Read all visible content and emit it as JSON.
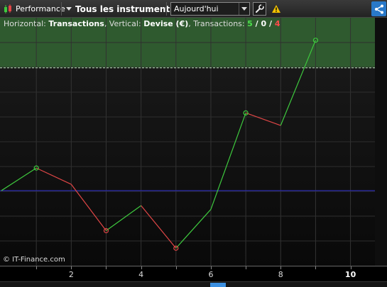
{
  "toolbar": {
    "performance_label": "Performance",
    "instruments_label": "Tous les instruments",
    "period_value": "Aujourd'hui",
    "icons": [
      "candlestick-icon",
      "chevron-down-icon",
      "wrench-icon",
      "warning-icon",
      "share-icon"
    ]
  },
  "chart": {
    "horizontal_prefix": "Horizontal: ",
    "horizontal_value": "Transactions",
    "vertical_prefix": ", Vertical: ",
    "vertical_value": "Devise (€)",
    "transactions_prefix": ", Transactions: ",
    "wins": "5",
    "sep1": " / ",
    "neutral": "0",
    "sep2": " / ",
    "losses": "4",
    "copyright": "© IT-Finance.com"
  },
  "colors": {
    "gain": "#3ec93e",
    "loss": "#e04646",
    "baseline": "#2a2acc",
    "target_zone": "#2f5a2f",
    "share": "#2979c9"
  },
  "chart_data": {
    "type": "line",
    "x": [
      0,
      1,
      2,
      3,
      4,
      5,
      6,
      7,
      8,
      9
    ],
    "y": [
      0,
      0.9,
      0.25,
      -1.6,
      -0.6,
      -2.3,
      -0.75,
      3.1,
      2.6,
      6.0
    ],
    "baseline_y": 0,
    "xlim": [
      0,
      10.7
    ],
    "ylim": [
      -3.0,
      6.9
    ],
    "target_level": 4.9,
    "x_tick_labels": [
      "2",
      "4",
      "6",
      "8",
      "10"
    ],
    "x_tick_values": [
      2,
      4,
      6,
      8,
      10
    ],
    "marked_points": [
      1,
      3,
      5,
      7,
      9
    ],
    "grid": true,
    "xlabel": "",
    "ylabel": ""
  }
}
